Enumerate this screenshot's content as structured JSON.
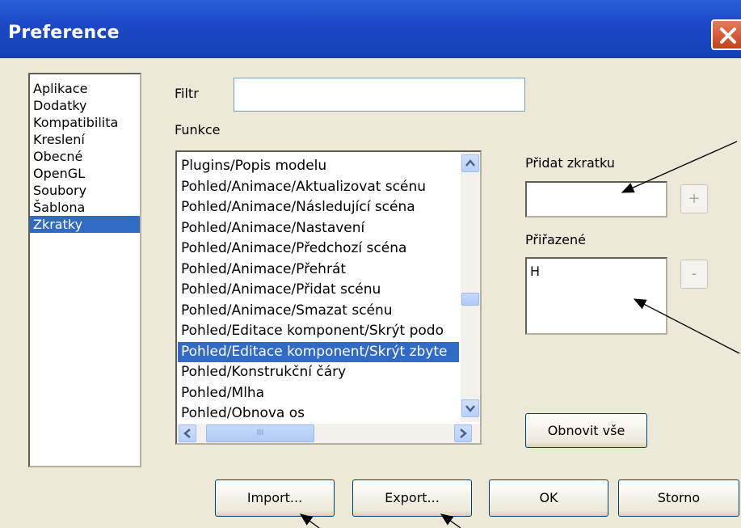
{
  "window": {
    "title": "Preference"
  },
  "categories": {
    "items": [
      "Aplikace",
      "Dodatky",
      "Kompatibilita",
      "Kreslení",
      "Obecné",
      "OpenGL",
      "Soubory",
      "Šablona",
      "Zkratky"
    ],
    "selected": "Zkratky"
  },
  "filter": {
    "label": "Filtr",
    "value": ""
  },
  "functions": {
    "label": "Funkce",
    "items": [
      "Plugins/Popis modelu",
      "Pohled/Animace/Aktualizovat scénu",
      "Pohled/Animace/Následující scéna",
      "Pohled/Animace/Nastavení",
      "Pohled/Animace/Předchozí scéna",
      "Pohled/Animace/Přehrát",
      "Pohled/Animace/Přidat scénu",
      "Pohled/Animace/Smazat scénu",
      "Pohled/Editace komponent/Skrýt podo",
      "Pohled/Editace komponent/Skrýt zbyte",
      "Pohled/Konstrukční čáry",
      "Pohled/Mlha",
      "Pohled/Obnova os"
    ],
    "selected": "Pohled/Editace komponent/Skrýt zbyte",
    "hscroll_grip": "III"
  },
  "shortcut": {
    "add_label": "Přidat zkratku",
    "add_value": "",
    "add_button": "+",
    "assigned_label": "Přiřazené",
    "assigned_items": [
      "H"
    ],
    "remove_button": "-",
    "reset_button": "Obnovit vše"
  },
  "buttons": {
    "import": "Import...",
    "export": "Export...",
    "ok": "OK",
    "cancel": "Storno"
  },
  "colors": {
    "titlebar": "#1b49c8",
    "selection": "#316ac5",
    "dialog_bg": "#ece9d8",
    "close_button": "#d4512a"
  }
}
